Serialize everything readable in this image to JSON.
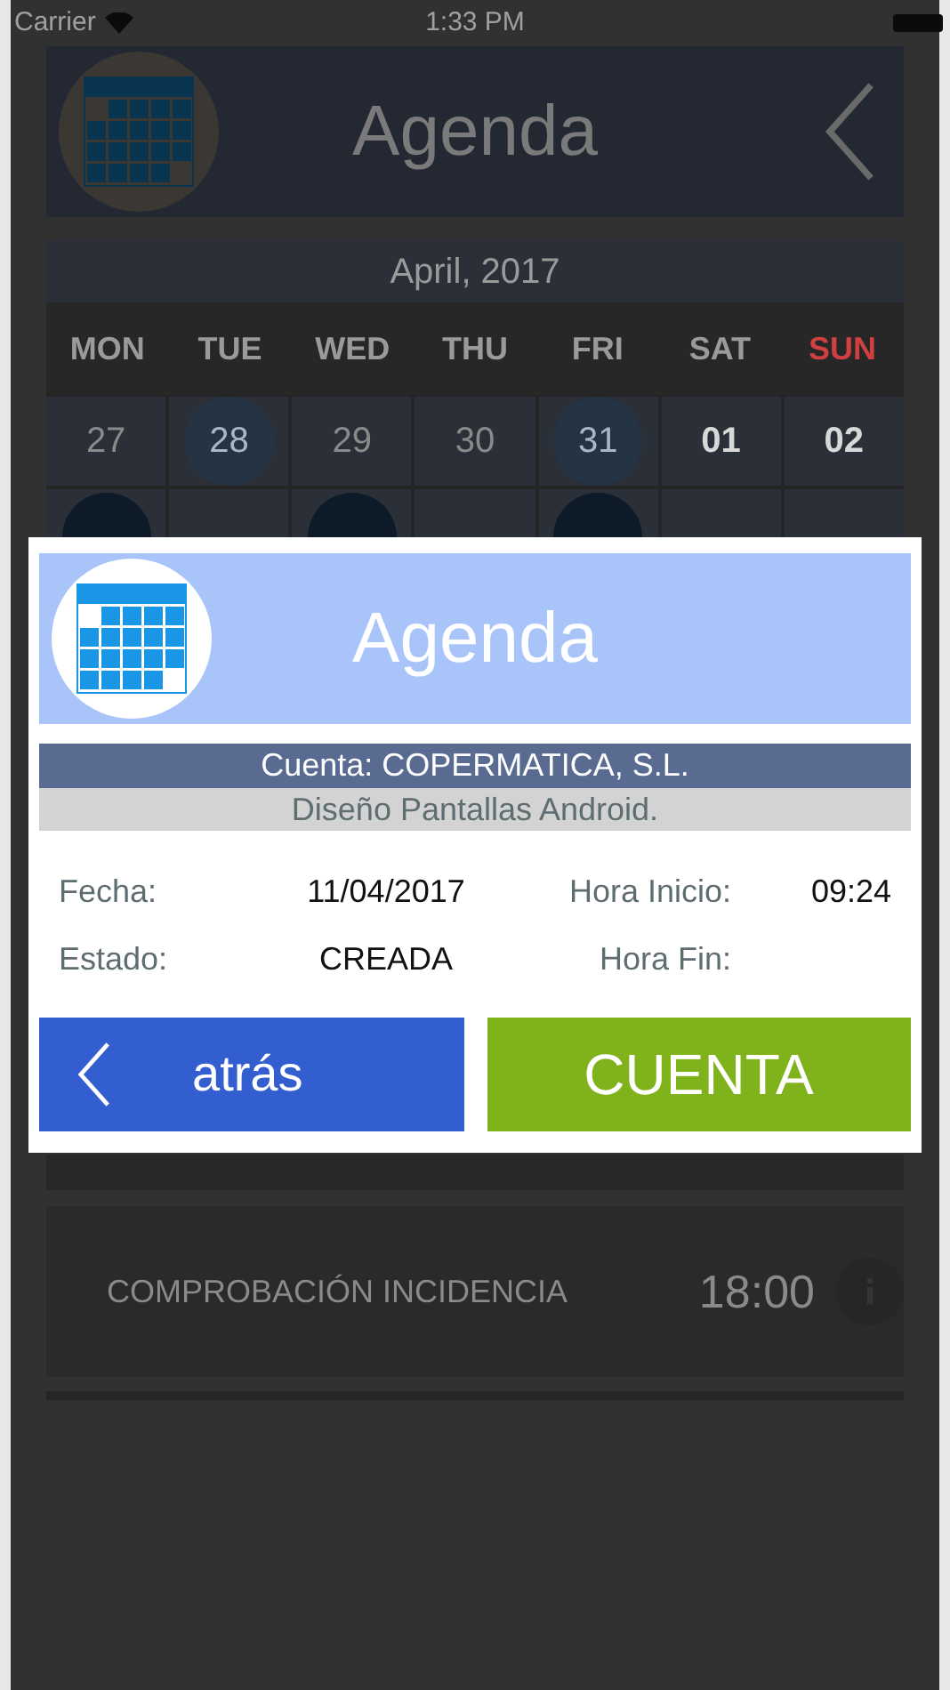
{
  "status_bar": {
    "carrier": "Carrier",
    "time": "1:33 PM"
  },
  "header": {
    "title": "Agenda"
  },
  "calendar": {
    "month": "April, 2017",
    "weekdays": [
      {
        "label": "MON",
        "weekend": false
      },
      {
        "label": "TUE",
        "weekend": false
      },
      {
        "label": "WED",
        "weekend": false
      },
      {
        "label": "THU",
        "weekend": false
      },
      {
        "label": "FRI",
        "weekend": false
      },
      {
        "label": "SAT",
        "weekend": false
      },
      {
        "label": "SUN",
        "weekend": true
      }
    ],
    "weeks": [
      [
        {
          "day": "27",
          "in_month": false,
          "kind": "plain"
        },
        {
          "day": "28",
          "in_month": false,
          "kind": "light"
        },
        {
          "day": "29",
          "in_month": false,
          "kind": "plain"
        },
        {
          "day": "30",
          "in_month": false,
          "kind": "plain"
        },
        {
          "day": "31",
          "in_month": false,
          "kind": "light"
        },
        {
          "day": "01",
          "in_month": true,
          "kind": "plain"
        },
        {
          "day": "02",
          "in_month": true,
          "kind": "plain"
        }
      ],
      [
        {
          "kind": "dark"
        },
        {
          "kind": "plain"
        },
        {
          "kind": "dark"
        },
        {
          "kind": "plain"
        },
        {
          "kind": "dark"
        },
        {
          "kind": "plain"
        },
        {
          "kind": "plain"
        }
      ]
    ]
  },
  "events": [
    {
      "title": "COMPROBACIÓN INCIDENCIA",
      "time": "18:00"
    }
  ],
  "dialog": {
    "title": "Agenda",
    "account": "Cuenta: COPERMATICA, S.L.",
    "description": "Diseño Pantallas Android.",
    "rows": [
      {
        "label": "Fecha:",
        "value": "11/04/2017",
        "label_2": "Hora Inicio:",
        "value_2": "09:24"
      },
      {
        "label": "Estado:",
        "value": "CREADA",
        "label_2": "Hora Fin:"
      }
    ],
    "buttons": [
      {
        "kind": "back",
        "label": "atrás"
      },
      {
        "kind": "primary",
        "label": "CUENTA"
      }
    ]
  }
}
